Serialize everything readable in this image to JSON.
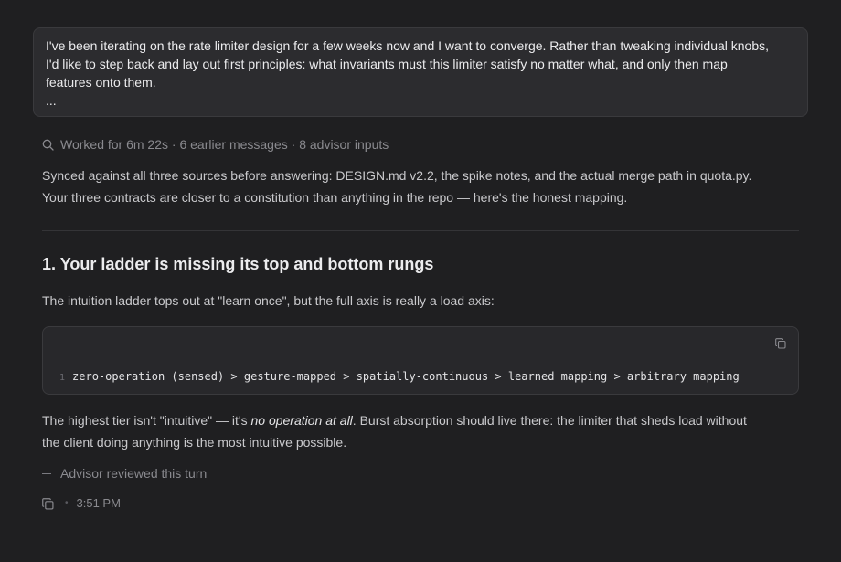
{
  "user_message": {
    "line1": "I've been iterating on the rate limiter design for a few weeks now and I want to converge. Rather than tweaking individual knobs,",
    "line2": "I'd like to step back and lay out first principles: what invariants must this limiter satisfy no matter what, and only then map",
    "line3": "features onto them.",
    "more": "..."
  },
  "meta": {
    "worked": "Worked for 6m 22s",
    "earlier": "6 earlier messages",
    "advisor_inputs": "8 advisor inputs",
    "separator": " · "
  },
  "intro": {
    "line1": "Synced against all three sources before answering: DESIGN.md v2.2, the spike notes, and the actual merge path in quota.py.",
    "line2": "Your three contracts are closer to a constitution than anything in the repo — here's the honest mapping."
  },
  "section": {
    "heading": "1. Your ladder is missing its top and bottom rungs",
    "para1": "The intuition ladder tops out at \"learn once\", but the full axis is really a load axis:"
  },
  "code": {
    "line_number": "1",
    "line": "zero-operation (sensed) > gesture-mapped > spatially-continuous > learned mapping > arbitrary mapping"
  },
  "para2": {
    "before": "The highest tier isn't \"intuitive\" — it's ",
    "emphasis": "no operation at all",
    "after": ". Burst absorption should live there: the limiter that sheds load without",
    "line2": "the client doing anything is the most intuitive possible."
  },
  "advisor": {
    "label": "Advisor reviewed this turn"
  },
  "footer": {
    "dot": "•",
    "time": "3:51 PM"
  }
}
